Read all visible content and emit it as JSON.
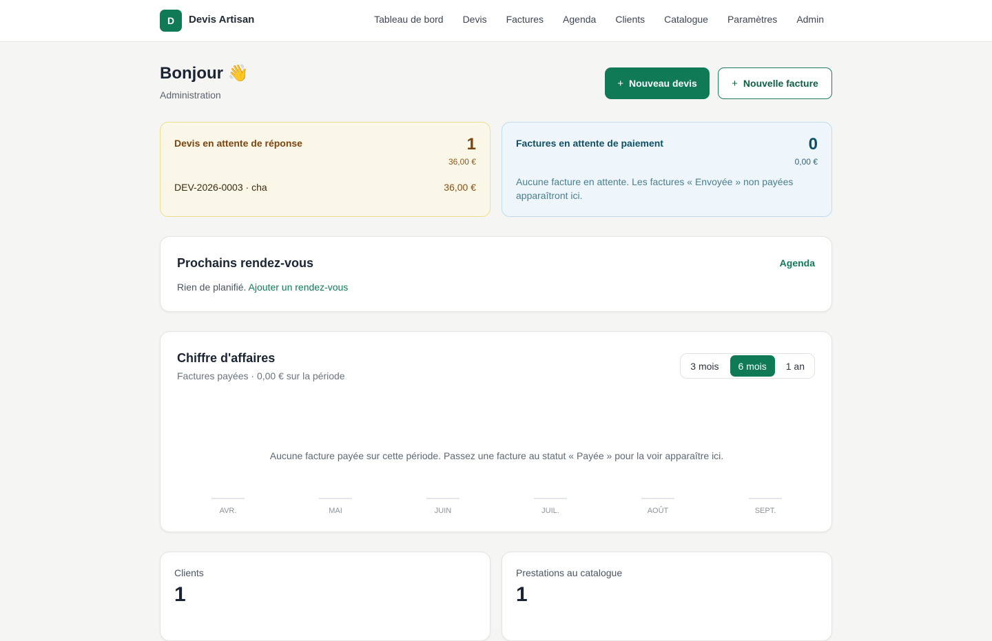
{
  "header": {
    "logo_letter": "D",
    "brand": "Devis Artisan",
    "nav": [
      "Tableau de bord",
      "Devis",
      "Factures",
      "Agenda",
      "Clients",
      "Catalogue",
      "Paramètres",
      "Admin"
    ]
  },
  "hero": {
    "greeting": "Bonjour 👋",
    "subtitle": "Administration",
    "new_quote_label": "Nouveau devis",
    "new_invoice_label": "Nouvelle facture",
    "plus": "+"
  },
  "pending_quotes": {
    "title": "Devis en attente de réponse",
    "count": "1",
    "total": "36,00 €",
    "items": [
      {
        "label": "DEV-2026-0003 · cha",
        "amount": "36,00 €"
      }
    ]
  },
  "pending_invoices": {
    "title": "Factures en attente de paiement",
    "count": "0",
    "total": "0,00 €",
    "empty_text": "Aucune facture en attente. Les factures « Envoyée » non payées apparaîtront ici."
  },
  "appointments": {
    "title": "Prochains rendez-vous",
    "link": "Agenda",
    "empty_text": "Rien de planifié.",
    "add_link": "Ajouter un rendez-vous"
  },
  "revenue": {
    "title": "Chiffre d'affaires",
    "subtitle": "Factures payées · 0,00 € sur la période",
    "ranges": [
      "3 mois",
      "6 mois",
      "1 an"
    ],
    "active_range": "6 mois",
    "empty_text": "Aucune facture payée sur cette période. Passez une facture au statut « Payée » pour la voir apparaître ici."
  },
  "chart_data": {
    "type": "bar",
    "categories": [
      "AVR.",
      "MAI",
      "JUIN",
      "JUIL.",
      "AOÛT",
      "SEPT."
    ],
    "values": [
      0,
      0,
      0,
      0,
      0,
      0
    ],
    "title": "",
    "xlabel": "",
    "ylabel": "",
    "grid": false,
    "bar_color": "#e3e6ea"
  },
  "stats": {
    "clients_label": "Clients",
    "clients_value": "1",
    "catalog_label": "Prestations au catalogue",
    "catalog_value": "1"
  },
  "colors": {
    "accent": "#0f7a55",
    "background": "#f5f5f3"
  }
}
